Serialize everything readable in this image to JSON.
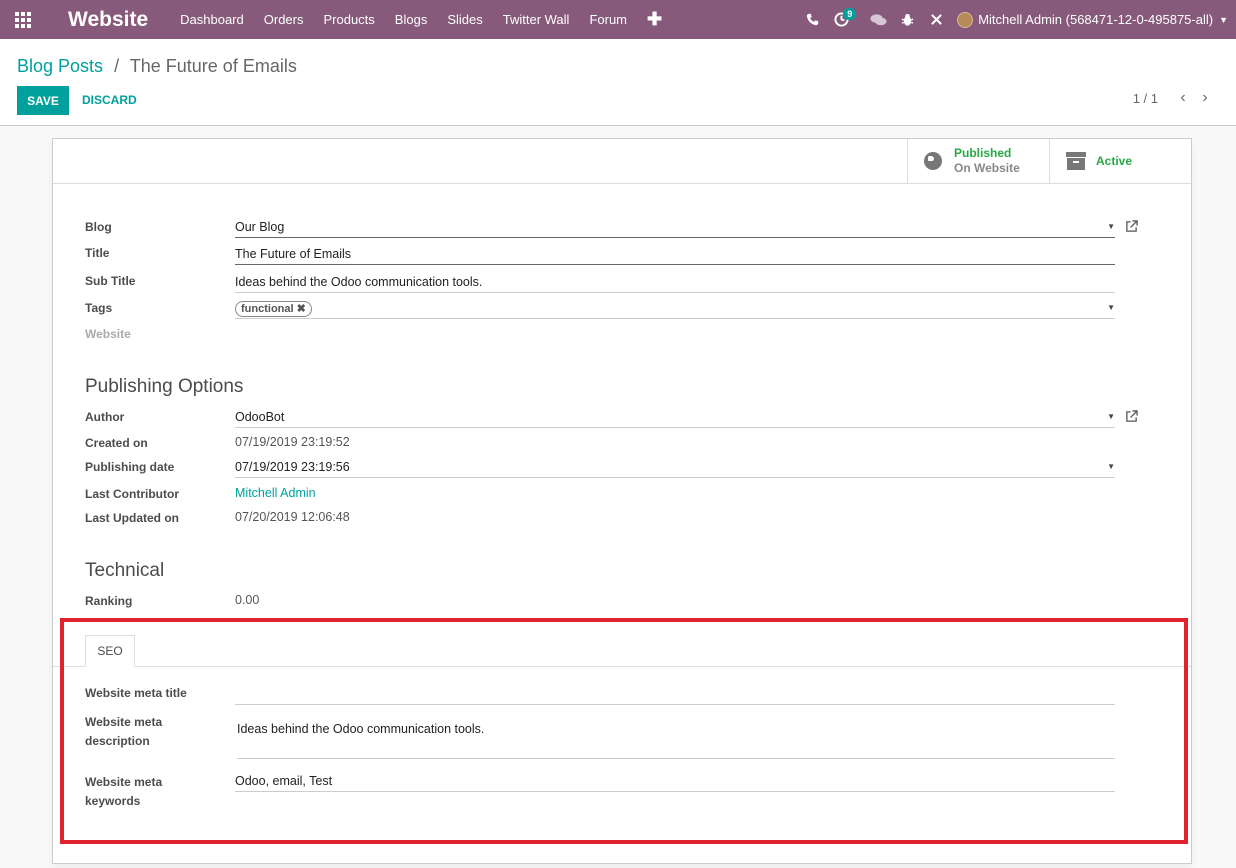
{
  "navbar": {
    "brand": "Website",
    "menu": [
      "Dashboard",
      "Orders",
      "Products",
      "Blogs",
      "Slides",
      "Twitter Wall",
      "Forum"
    ],
    "activity_badge": "9",
    "user": "Mitchell Admin (568471-12-0-495875-all)"
  },
  "breadcrumb": {
    "parent": "Blog Posts",
    "separator": "/",
    "current": "The Future of Emails"
  },
  "buttons": {
    "save": "SAVE",
    "discard": "DISCARD"
  },
  "pager": {
    "counter": "1 / 1"
  },
  "stat_buttons": {
    "published_line1": "Published",
    "published_line2": "On Website",
    "active": "Active"
  },
  "form": {
    "blog_label": "Blog",
    "blog_value": "Our Blog",
    "title_label": "Title",
    "title_value": "The Future of Emails",
    "subtitle_label": "Sub Title",
    "subtitle_value": "Ideas behind the Odoo communication tools.",
    "tags_label": "Tags",
    "tag_value": "functional",
    "website_label": "Website",
    "publishing_title": "Publishing Options",
    "author_label": "Author",
    "author_value": "OdooBot",
    "created_label": "Created on",
    "created_value": "07/19/2019 23:19:52",
    "pubdate_label": "Publishing date",
    "pubdate_value": "07/19/2019 23:19:56",
    "contributor_label": "Last Contributor",
    "contributor_value": "Mitchell Admin",
    "updated_label": "Last Updated on",
    "updated_value": "07/20/2019 12:06:48",
    "technical_title": "Technical",
    "ranking_label": "Ranking",
    "ranking_value": "0.00"
  },
  "seo": {
    "tab_label": "SEO",
    "meta_title_label": "Website meta title",
    "meta_title_value": "",
    "meta_desc_label_1": "Website meta",
    "meta_desc_label_2": "description",
    "meta_desc_value": "Ideas behind the Odoo communication tools.",
    "meta_keywords_label_1": "Website meta",
    "meta_keywords_label_2": "keywords",
    "meta_keywords_value": "Odoo, email, Test"
  },
  "colors": {
    "navbar": "#875a7b",
    "accent": "#00a09d",
    "published": "#28a745",
    "highlight": "#e0232e"
  }
}
